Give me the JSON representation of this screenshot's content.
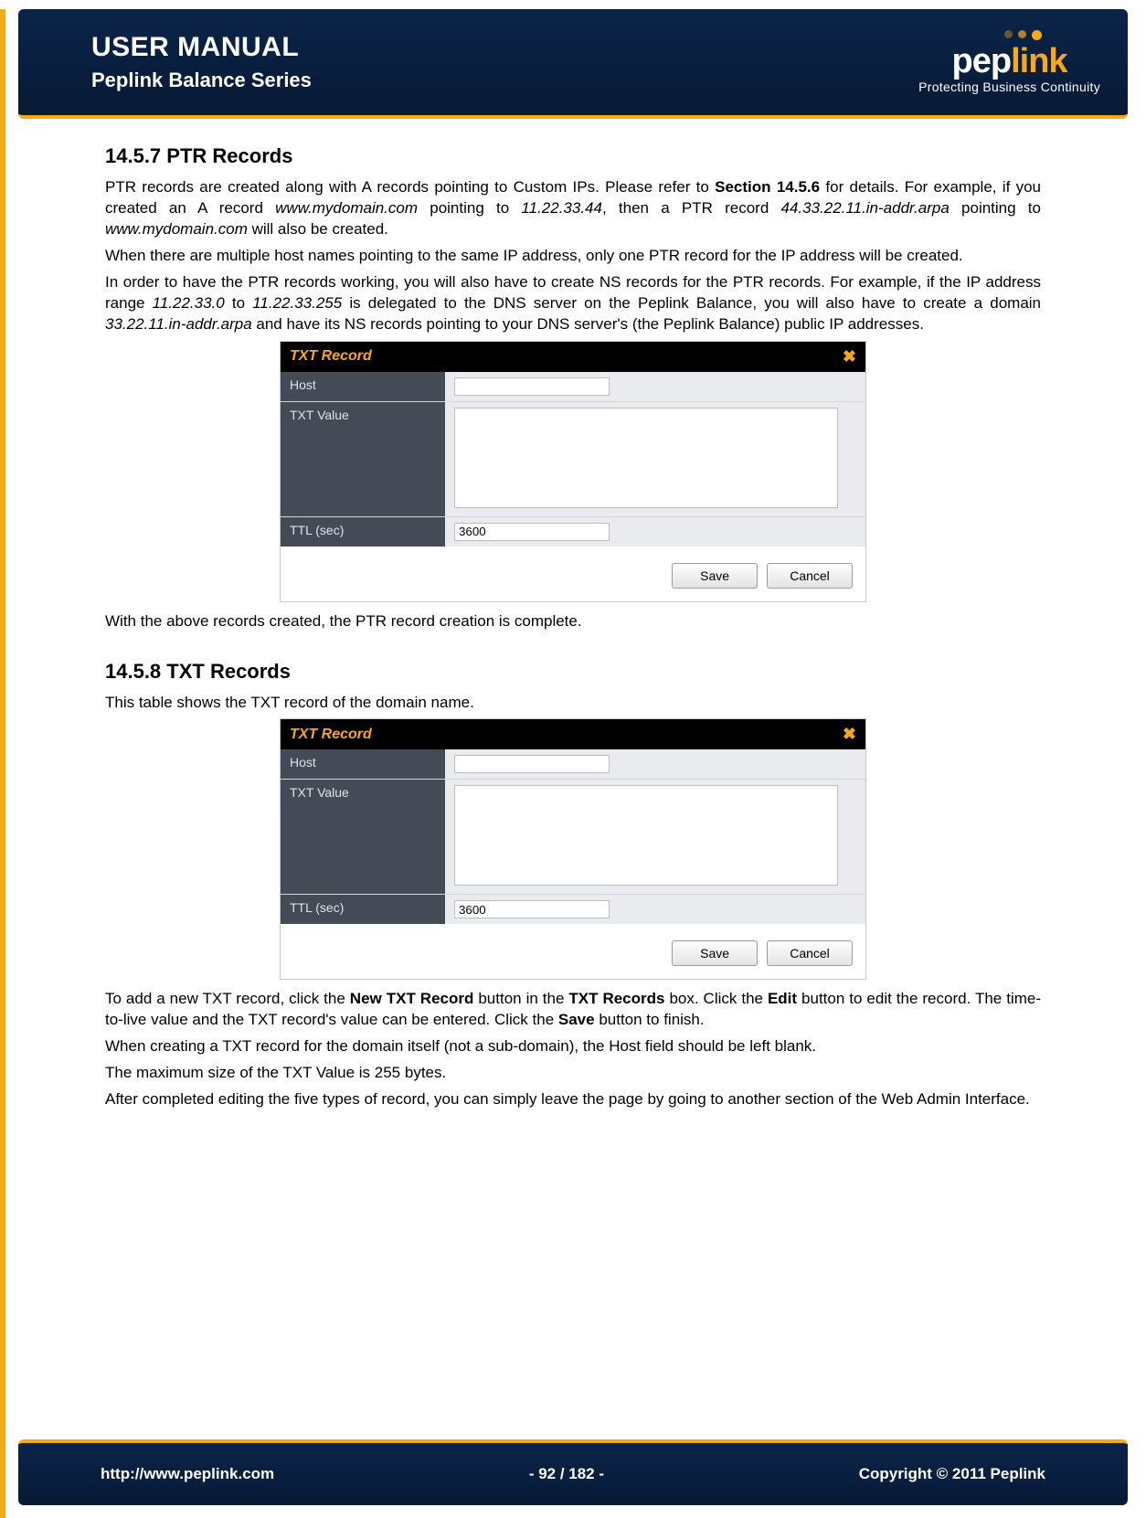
{
  "header": {
    "title": "USER MANUAL",
    "subtitle": "Peplink Balance Series",
    "brand_left": "pep",
    "brand_right": "link",
    "tagline": "Protecting Business Continuity"
  },
  "section_ptr": {
    "heading": "14.5.7 PTR Records",
    "p1_a": "PTR records are created along with A records pointing to Custom IPs.  Please refer to ",
    "p1_b_bold": "Section 14.5.6",
    "p1_c": " for details. For example, if you created an A record ",
    "p1_d_it": "www.mydomain.com",
    "p1_e": " pointing to ",
    "p1_f_it": "11.22.33.44",
    "p1_g": ", then a PTR record ",
    "p1_h_it": "44.33.22.11.in-addr.arpa",
    "p1_i": " pointing to ",
    "p1_j_it": "www.mydomain.com",
    "p1_k": " will also be created.",
    "p2": "When there are multiple host names pointing to the same IP address, only one PTR record for the IP address will be created.",
    "p3_a": "In order to have the PTR records working, you will also have to create NS records for the PTR records. For example, if the IP address range ",
    "p3_b_it": "11.22.33.0",
    "p3_c": " to ",
    "p3_d_it": "11.22.33.255",
    "p3_e": " is delegated to the DNS server on the Peplink Balance, you will also have to create a domain ",
    "p3_f_it": "33.22.11.in-addr.arpa",
    "p3_g": " and have its NS records pointing to your DNS server's (the Peplink Balance) public IP addresses.",
    "p4": "With the above records created, the PTR record creation is complete."
  },
  "section_txt": {
    "heading": "14.5.8 TXT Records",
    "p1": "This table shows the TXT record of the domain name.",
    "p2_a": "To add a new TXT record, click the ",
    "p2_b_bold": "New TXT Record",
    "p2_c": " button in the ",
    "p2_d_bold": "TXT Records",
    "p2_e": " box. Click the ",
    "p2_f_bold": "Edit",
    "p2_g": " button to edit the record.  The time-to-live value and the TXT record's value can be entered.  Click the ",
    "p2_h_bold": "Save",
    "p2_i": " button to finish.",
    "p3": "When creating a TXT record for the domain itself (not a sub-domain), the Host field should be left blank.",
    "p4": "The maximum size of the TXT Value is 255 bytes.",
    "p5": "After completed editing the five types of record, you can simply leave the page by going to another section of the Web Admin Interface."
  },
  "txt_panel": {
    "title": "TXT Record",
    "host_label": "Host",
    "host_value": "",
    "txtval_label": "TXT Value",
    "txtval_value": "",
    "ttl_label": "TTL (sec)",
    "ttl_value": "3600",
    "save_label": "Save",
    "cancel_label": "Cancel",
    "close_glyph": "✖"
  },
  "footer": {
    "url": "http://www.peplink.com",
    "page": "- 92 / 182 -",
    "copyright": "Copyright © 2011 Peplink"
  }
}
